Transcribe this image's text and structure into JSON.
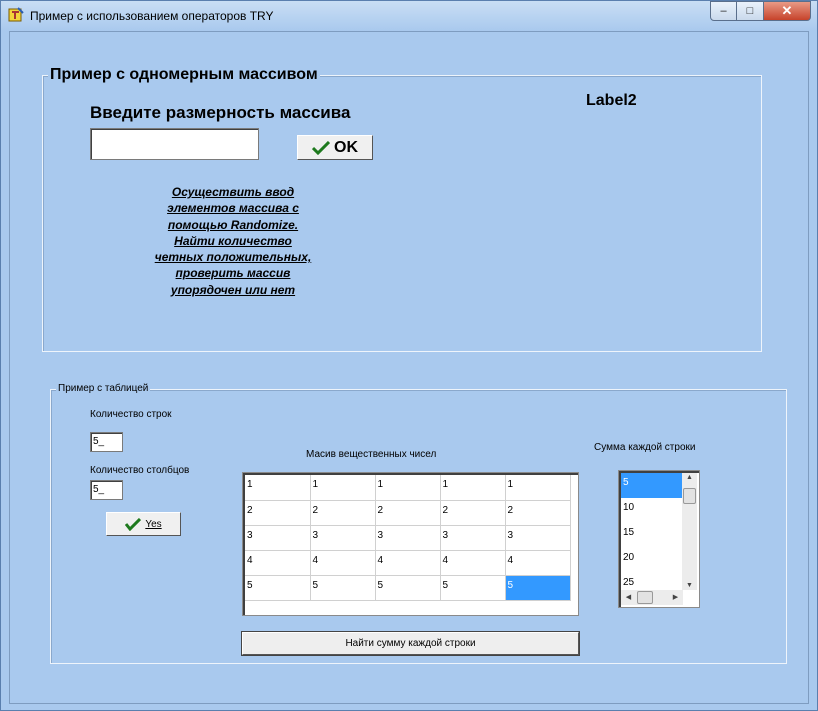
{
  "window": {
    "title": "Пример с использованием операторов TRY",
    "min_glyph": "–",
    "max_glyph": "□",
    "close_glyph": "✕"
  },
  "group1": {
    "title": "Пример с одномерным массивом",
    "size_label": "Введите размерность массива",
    "label2": "Label2",
    "size_input_value": "",
    "ok_label": "OK",
    "task_lines": [
      "Осуществить ввод",
      "элементов массива с",
      "помощью Randomize.",
      "Найти количество",
      "четных положительных,",
      "проверить массив",
      "упорядочен или нет"
    ]
  },
  "group2": {
    "title": "Пример с таблицей",
    "rows_label": "Количество строк",
    "rows_value": "5_",
    "cols_label": "Количество столбцов",
    "cols_value": "5_",
    "yes_label": "Yes",
    "grid_caption": "Масив вещественных чисел",
    "grid": [
      [
        "1",
        "1",
        "1",
        "1",
        "1"
      ],
      [
        "2",
        "2",
        "2",
        "2",
        "2"
      ],
      [
        "3",
        "3",
        "3",
        "3",
        "3"
      ],
      [
        "4",
        "4",
        "4",
        "4",
        "4"
      ],
      [
        "5",
        "5",
        "5",
        "5",
        "5"
      ]
    ],
    "sum_button_label": "Найти сумму каждой строки",
    "sums_caption": "Сумма каждой строки",
    "sums": [
      "5",
      "10",
      "15",
      "20",
      "25"
    ]
  },
  "colors": {
    "form_bg": "#a9c9ee",
    "selection": "#3399ff",
    "check_green": "#1e7a1e"
  }
}
